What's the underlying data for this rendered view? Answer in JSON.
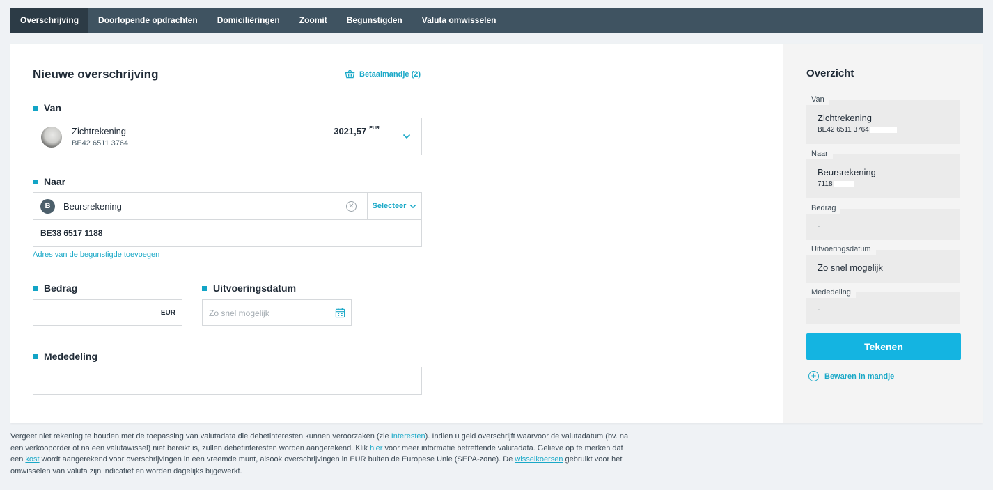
{
  "tabs": [
    {
      "label": "Overschrijving",
      "active": true
    },
    {
      "label": "Doorlopende opdrachten"
    },
    {
      "label": "Domiciliëringen"
    },
    {
      "label": "Zoomit"
    },
    {
      "label": "Begunstigden"
    },
    {
      "label": "Valuta omwisselen"
    }
  ],
  "form": {
    "title": "Nieuwe overschrijving",
    "basket_link": "Betaalmandje (2)",
    "van": {
      "label": "Van",
      "account_name": "Zichtrekening",
      "iban": "BE42 6511 3764",
      "amount": "3021,57",
      "currency": "EUR"
    },
    "naar": {
      "label": "Naar",
      "avatar_letter": "B",
      "name": "Beursrekening",
      "select_label": "Selecteer",
      "iban": "BE38 6517 1188",
      "address_link": "Adres van de begunstigde toevoegen"
    },
    "bedrag": {
      "label": "Bedrag",
      "value": "",
      "currency": "EUR"
    },
    "uitvoeringsdatum": {
      "label": "Uitvoeringsdatum",
      "placeholder": "Zo snel mogelijk"
    },
    "mededeling": {
      "label": "Mededeling",
      "value": ""
    }
  },
  "overview": {
    "title": "Overzicht",
    "van": {
      "label": "Van",
      "name": "Zichtrekening",
      "iban": "BE42 6511 3764"
    },
    "naar": {
      "label": "Naar",
      "name": "Beursrekening",
      "iban": "7118"
    },
    "bedrag": {
      "label": "Bedrag",
      "value": "-"
    },
    "uitvoeringsdatum": {
      "label": "Uitvoeringsdatum",
      "value": "Zo snel mogelijk"
    },
    "mededeling": {
      "label": "Mededeling",
      "value": "-"
    },
    "sign_button": "Tekenen",
    "save_link": "Bewaren in mandje"
  },
  "footnote": {
    "p1": "Vergeet niet rekening te houden met de toepassing van valutadata die debetinteresten kunnen veroorzaken (zie ",
    "link_interesten": "Interesten",
    "p2": "). Indien u geld overschrijft waarvoor de valutadatum (bv. na een verkooporder of na een valutawissel) niet bereikt is, zullen debetinteresten worden aangerekend. Klik ",
    "link_hier": "hier",
    "p3": " voor meer informatie betreffende valutadata. Gelieve op te merken dat een ",
    "link_kost": "kost",
    "p4": " wordt aangerekend voor overschrijvingen in een vreemde munt, alsook overschrijvingen in EUR buiten de Europese Unie (SEPA-zone). De ",
    "link_wisselkoersen": "wisselkoersen",
    "p5": " gebruikt voor het omwisselen van valuta zijn indicatief en worden dagelijks bijgewerkt."
  },
  "colors": {
    "accent": "#19a8c7",
    "tabbar": "#3f5361",
    "tab_active": "#2c3b46",
    "sign_button": "#14b4e1"
  }
}
